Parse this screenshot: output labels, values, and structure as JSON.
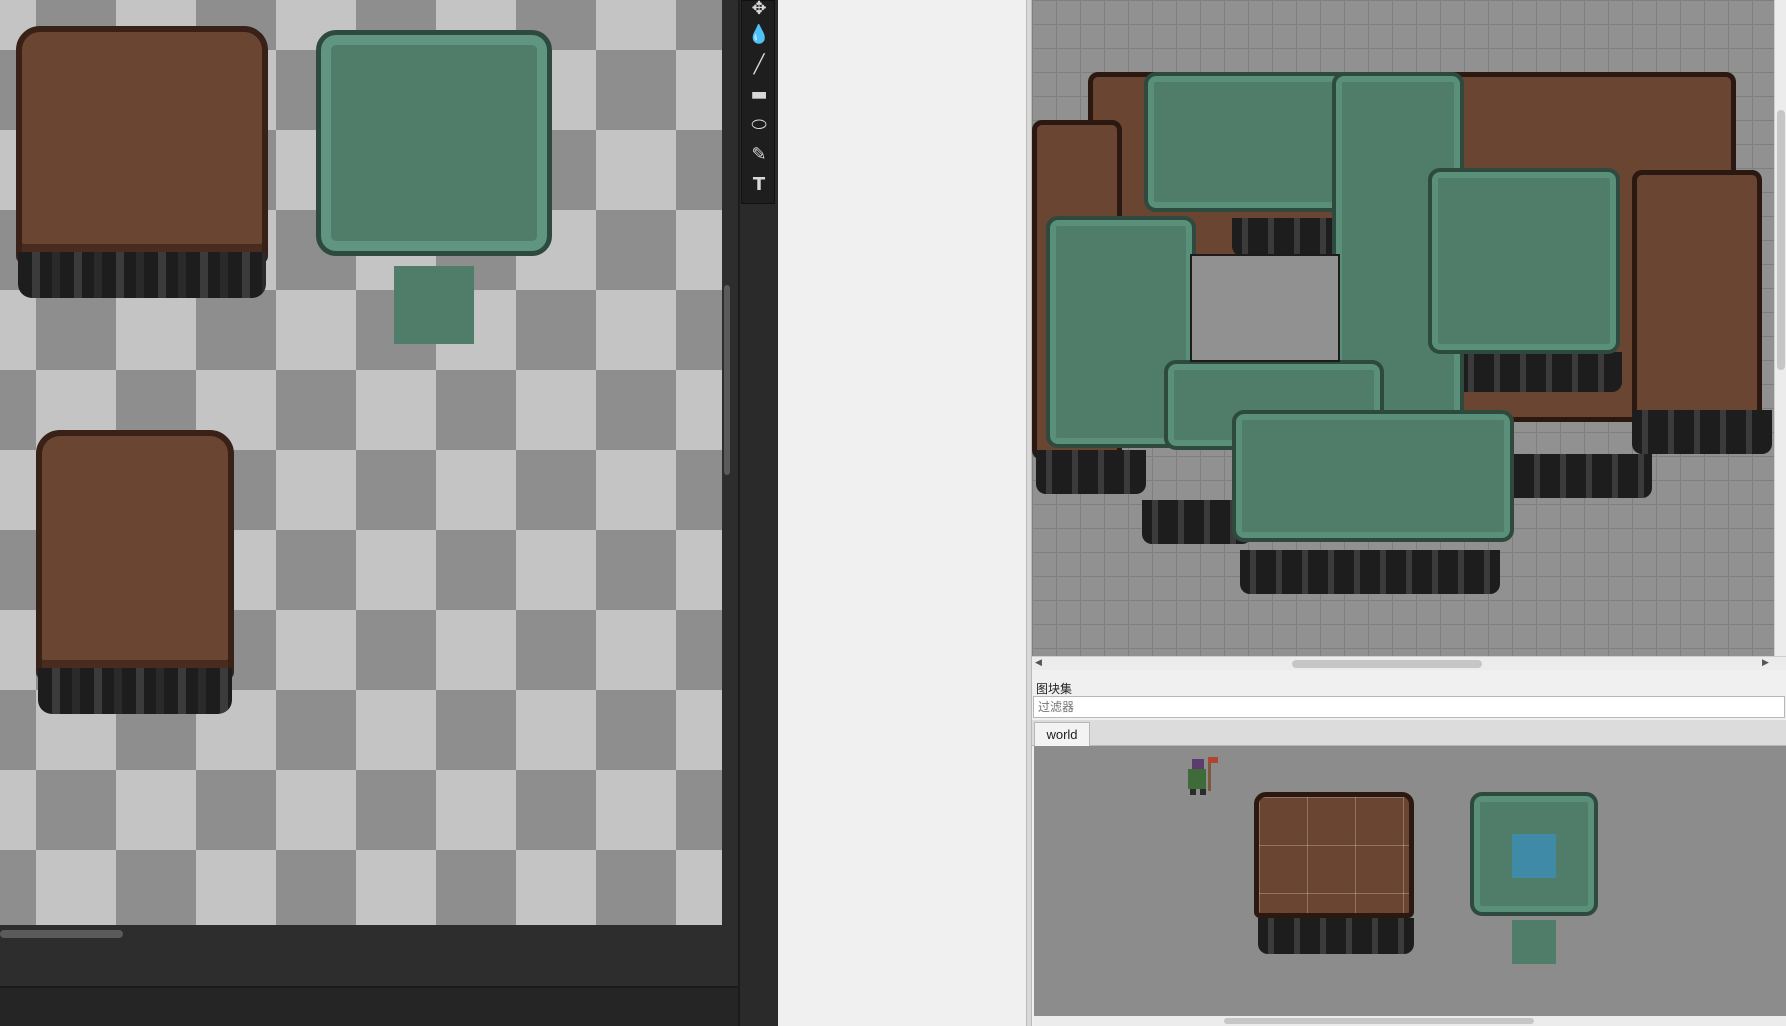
{
  "tileset_panel": {
    "title": "图块集",
    "filter_placeholder": "过滤器",
    "tabs": [
      {
        "label": "world",
        "selected": true
      }
    ]
  },
  "toolbar": {
    "tools": [
      {
        "name": "move",
        "glyph": "✥"
      },
      {
        "name": "fill",
        "glyph": "💧"
      },
      {
        "name": "line",
        "glyph": "╱"
      },
      {
        "name": "rectangle",
        "glyph": "▬"
      },
      {
        "name": "ellipse",
        "glyph": "⬭"
      },
      {
        "name": "brush",
        "glyph": "✎"
      },
      {
        "name": "text",
        "glyph": "T"
      }
    ]
  },
  "colors": {
    "dirt": "#6a4532",
    "grass": "#4f7d6a",
    "rock": "#1d1d1d",
    "selected_tile": "#3f8aa6",
    "map_background": "#919191"
  }
}
